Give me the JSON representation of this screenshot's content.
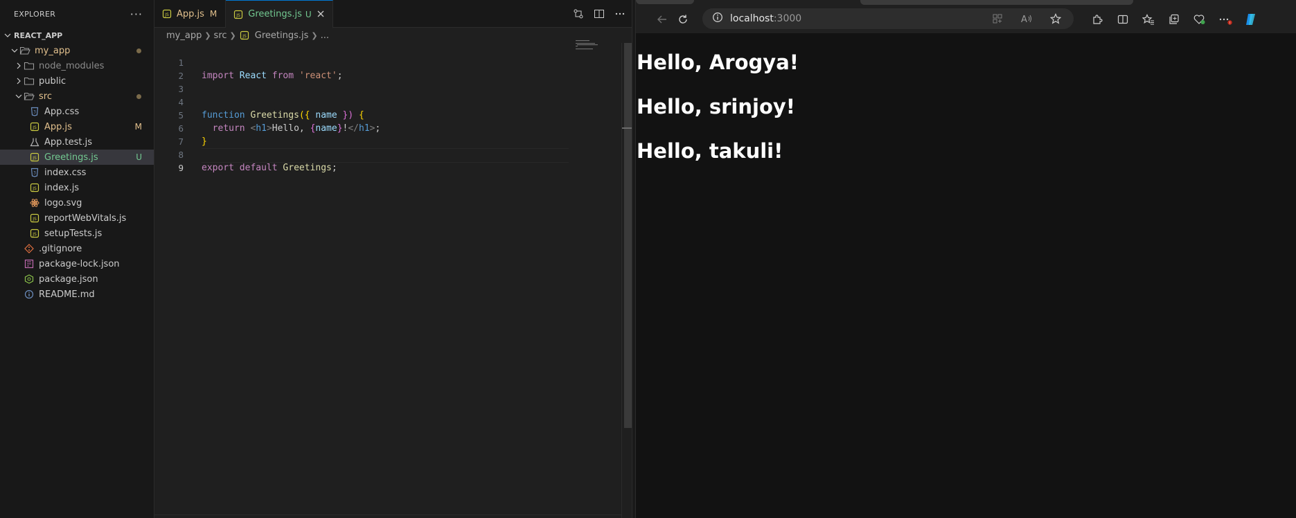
{
  "explorer": {
    "title": "EXPLORER",
    "more_label": "···",
    "root": "REACT_APP",
    "items": [
      {
        "label": "my_app",
        "kind": "folder-open",
        "level": 1,
        "status": "dot",
        "color": "#e2c08d"
      },
      {
        "label": "node_modules",
        "kind": "folder",
        "level": 2,
        "status": "",
        "color": "#8b8b8b"
      },
      {
        "label": "public",
        "kind": "folder",
        "level": 2,
        "status": "",
        "color": "#cccccc"
      },
      {
        "label": "src",
        "kind": "folder-open",
        "level": 2,
        "status": "dot",
        "color": "#e2c08d"
      },
      {
        "label": "App.css",
        "kind": "css",
        "level": 3,
        "status": "",
        "color": "#cccccc"
      },
      {
        "label": "App.js",
        "kind": "js",
        "level": 3,
        "status": "M",
        "color": "#e2c08d"
      },
      {
        "label": "App.test.js",
        "kind": "test",
        "level": 3,
        "status": "",
        "color": "#cccccc"
      },
      {
        "label": "Greetings.js",
        "kind": "js",
        "level": 3,
        "status": "U",
        "color": "#73c991",
        "selected": true
      },
      {
        "label": "index.css",
        "kind": "css",
        "level": 3,
        "status": "",
        "color": "#cccccc"
      },
      {
        "label": "index.js",
        "kind": "js",
        "level": 3,
        "status": "",
        "color": "#cccccc"
      },
      {
        "label": "logo.svg",
        "kind": "svg",
        "level": 3,
        "status": "",
        "color": "#cccccc"
      },
      {
        "label": "reportWebVitals.js",
        "kind": "js",
        "level": 3,
        "status": "",
        "color": "#cccccc"
      },
      {
        "label": "setupTests.js",
        "kind": "js",
        "level": 3,
        "status": "",
        "color": "#cccccc"
      },
      {
        "label": ".gitignore",
        "kind": "git",
        "level": 2,
        "status": "",
        "color": "#cccccc"
      },
      {
        "label": "package-lock.json",
        "kind": "lock",
        "level": 2,
        "status": "",
        "color": "#cccccc"
      },
      {
        "label": "package.json",
        "kind": "npm",
        "level": 2,
        "status": "",
        "color": "#cccccc"
      },
      {
        "label": "README.md",
        "kind": "info",
        "level": 2,
        "status": "",
        "color": "#cccccc"
      }
    ]
  },
  "tabs": [
    {
      "label": "App.js",
      "status": "M",
      "color": "#e2c08d",
      "active": false
    },
    {
      "label": "Greetings.js",
      "status": "U",
      "color": "#73c991",
      "active": true
    }
  ],
  "breadcrumb": [
    "my_app",
    "src",
    "Greetings.js",
    "..."
  ],
  "code": {
    "line_numbers": [
      "1",
      "2",
      "3",
      "4",
      "5",
      "6",
      "7",
      "8",
      "9"
    ],
    "l1": {
      "import": "import",
      "React": "React",
      "from": "from",
      "str": "'react'",
      "semi": ";"
    },
    "l4": {
      "function": "function",
      "name": "Greetings",
      "open": "({",
      "param": "name",
      "close": "})",
      "brace": "{"
    },
    "l5": {
      "return": "return",
      "lt": "<",
      "tag": "h1",
      "gt": ">",
      "text": "Hello, ",
      "ob": "{",
      "var": "name",
      "cb": "}",
      "excl": "!",
      "lt2": "</",
      "tag2": "h1",
      "gt2": ">",
      "semi": ";"
    },
    "l6": {
      "brace": "}"
    },
    "l8": {
      "export": "export",
      "default": "default",
      "name": "Greetings",
      "semi": ";"
    }
  },
  "browser": {
    "host": "localhost",
    "port": ":3000",
    "headings": [
      "Hello, Arogya!",
      "Hello, srinjoy!",
      "Hello, takuli!"
    ]
  },
  "colors": {
    "accent": "#0078d4",
    "modified": "#e2c08d",
    "untracked": "#73c991"
  }
}
